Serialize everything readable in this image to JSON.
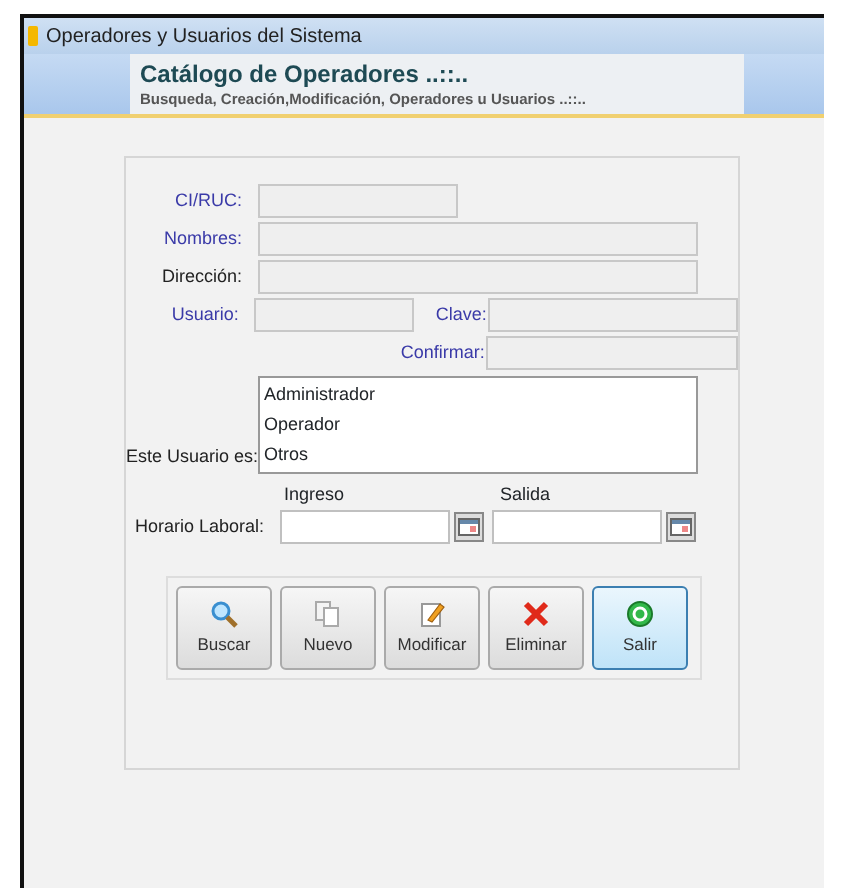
{
  "window": {
    "title": "Operadores y Usuarios del Sistema"
  },
  "header": {
    "title": "Catálogo de Operadores ..::..",
    "subtitle": "Busqueda, Creación,Modificación,  Operadores u Usuarios ..::.."
  },
  "fields": [
    {
      "label": "CI/RUC:",
      "required": true,
      "kind": "short"
    },
    {
      "label": "Nombres:",
      "required": true,
      "kind": "long"
    },
    {
      "label": "Dirección:",
      "required": false,
      "kind": "long"
    }
  ],
  "user_row": {
    "label": "Usuario:",
    "required": true,
    "password_label": "Clave:",
    "confirm_label": "Confirmar:"
  },
  "user_type": {
    "label": "Este Usuario es:",
    "options": [
      {
        "label": "Administrador",
        "selected": false
      },
      {
        "label": "Operador",
        "selected": false
      },
      {
        "label": "Otros",
        "selected": false
      }
    ]
  },
  "schedule": {
    "label": "Horario Laboral:",
    "start_label": "Ingreso",
    "end_label": "Salida"
  },
  "buttons": [
    {
      "label": "Buscar",
      "kind": "search",
      "focused": false
    },
    {
      "label": "Nuevo",
      "kind": "new",
      "focused": false
    },
    {
      "label": "Modificar",
      "kind": "edit",
      "focused": false
    },
    {
      "label": "Eliminar",
      "kind": "delete",
      "focused": false
    },
    {
      "label": "Salir",
      "kind": "exit",
      "focused": true
    }
  ]
}
